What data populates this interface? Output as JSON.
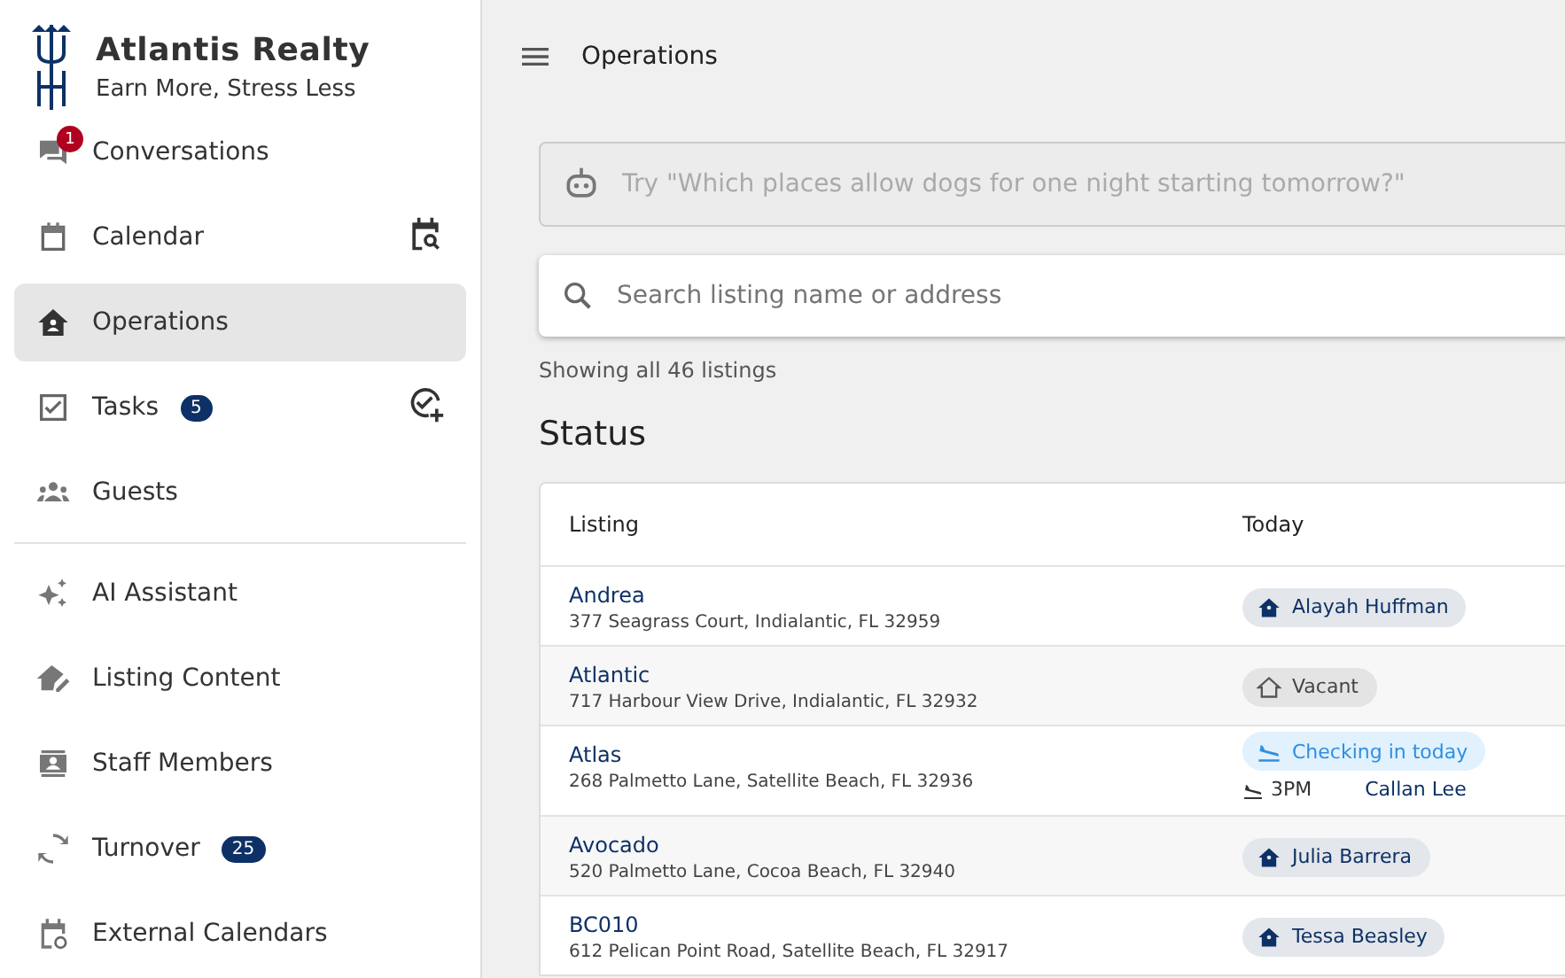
{
  "brand": {
    "name": "Atlantis Realty",
    "tagline": "Earn More, Stress Less"
  },
  "sidebar": {
    "sections": [
      {
        "items": [
          {
            "label": "Conversations",
            "selected": false,
            "badge": {
              "text": "1",
              "color": "#b00020",
              "kind": "overlay"
            }
          },
          {
            "label": "Calendar",
            "selected": false,
            "kind": "calendar-action"
          },
          {
            "label": "Operations",
            "selected": true
          },
          {
            "label": "Tasks",
            "selected": false,
            "badge": {
              "text": "5",
              "color": "#0d3166",
              "kind": "pill"
            },
            "kind": "task-action"
          },
          {
            "label": "Guests",
            "selected": false
          }
        ]
      },
      {
        "items": [
          {
            "label": "AI Assistant",
            "selected": false
          },
          {
            "label": "Listing Content",
            "selected": false
          },
          {
            "label": "Staff Members",
            "selected": false
          },
          {
            "label": "Turnover",
            "selected": false,
            "badge": {
              "text": "25",
              "color": "#0d3166",
              "kind": "pill"
            }
          },
          {
            "label": "External Calendars",
            "selected": false
          }
        ]
      }
    ]
  },
  "header": {
    "title": "Operations"
  },
  "ai_search": {
    "placeholder": "Try \"Which places allow dogs for one night starting tomorrow?\""
  },
  "search": {
    "placeholder": "Search listing name or address"
  },
  "result_count": "Showing all 46 listings",
  "section_title": "Status",
  "table": {
    "columns": [
      "Listing",
      "Today"
    ],
    "rows": [
      {
        "name": "Andrea",
        "address": "377 Seagrass Court, Indialantic, FL 32959",
        "status": {
          "kind": "occupied",
          "label": "Alayah Huffman"
        }
      },
      {
        "name": "Atlantic",
        "address": "717 Harbour View Drive, Indialantic, FL 32932",
        "status": {
          "kind": "vacant",
          "label": "Vacant"
        }
      },
      {
        "name": "Atlas",
        "address": "268 Palmetto Lane, Satellite Beach, FL 32936",
        "status": {
          "kind": "checkin",
          "label": "Checking in today",
          "time": "3PM",
          "guest": "Callan Lee"
        }
      },
      {
        "name": "Avocado",
        "address": "520 Palmetto Lane, Cocoa Beach, FL 32940",
        "status": {
          "kind": "occupied",
          "label": "Julia Barrera"
        }
      },
      {
        "name": "BC010",
        "address": "612 Pelican Point Road, Satellite Beach, FL 32917",
        "status": {
          "kind": "occupied",
          "label": "Tessa Beasley"
        }
      }
    ]
  }
}
